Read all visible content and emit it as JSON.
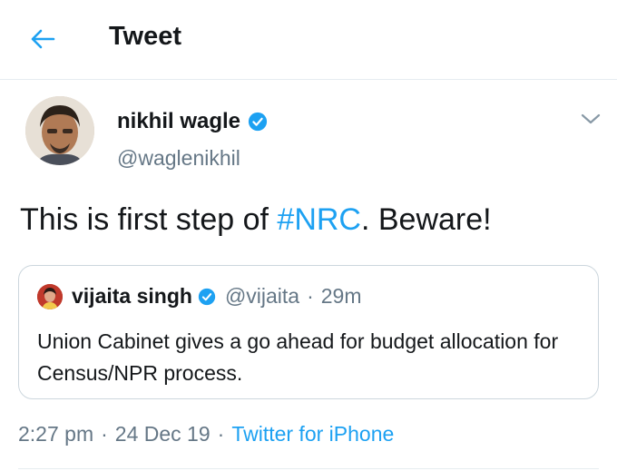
{
  "header": {
    "back_icon": "arrow-left-icon",
    "title": "Tweet"
  },
  "author": {
    "display_name": "nikhil wagle",
    "handle": "@waglenikhil",
    "verified_icon": "verified-badge-icon",
    "menu_icon": "chevron-down-icon"
  },
  "tweet": {
    "text_before": "This is first step of ",
    "hashtag": "#NRC",
    "text_after": ". Beware!"
  },
  "quoted_tweet": {
    "display_name": "vijaita singh",
    "handle": "@vijaita",
    "separator": "·",
    "time": "29m",
    "text": "Union Cabinet gives a go ahead for budget allocation for Census/NPR process."
  },
  "meta": {
    "time": "2:27 pm",
    "separator": "·",
    "date": "24 Dec 19",
    "source": "Twitter for iPhone"
  },
  "colors": {
    "accent": "#1da1f2",
    "secondary_text": "#657786",
    "border": "#ccd6dd"
  }
}
